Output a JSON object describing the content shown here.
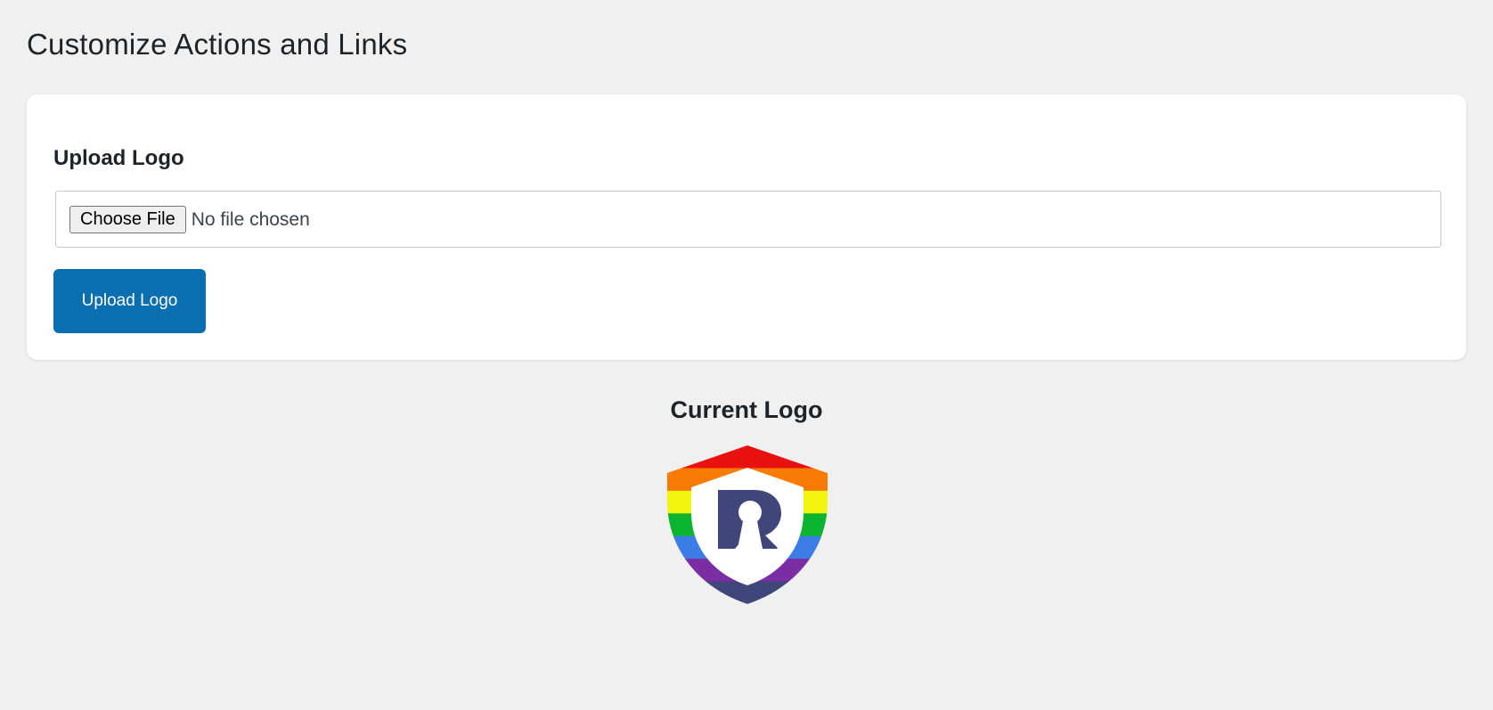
{
  "page": {
    "title": "Customize Actions and Links"
  },
  "upload_card": {
    "heading": "Upload Logo",
    "file_input": {
      "button_label": "Choose File",
      "status_text": "No file chosen"
    },
    "submit_label": "Upload Logo",
    "accent_color": "#0a6fb0"
  },
  "current_logo": {
    "heading": "Current Logo",
    "image": {
      "icon": "rainbow-shield-keyhole-r-logo",
      "stripe_colors": [
        "#e8110f",
        "#f77b05",
        "#f4f50e",
        "#0cb52f",
        "#3b7ce6",
        "#7b2ea4",
        "#41467a"
      ],
      "glyph_color": "#41467a"
    }
  }
}
